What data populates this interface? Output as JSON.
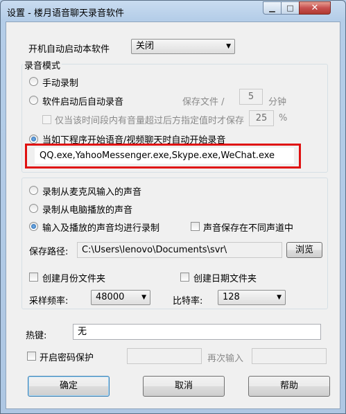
{
  "window": {
    "title": "设置 - 楼月语音聊天录音软件",
    "minimize_label": "▁",
    "maximize_label": "□",
    "close_label": "✕"
  },
  "autostart": {
    "label": "开机自动启动本软件",
    "value": "关闭"
  },
  "record_mode": {
    "title": "录音模式",
    "manual": "手动录制",
    "auto_on_start": "软件启动后自动录音",
    "save_file_label": "保存文件 /",
    "save_minutes": "5",
    "minutes_unit": "分钟",
    "volume_option": "仅当该时间段内有音量超过后方指定值时才保存",
    "volume_value": "25",
    "percent_unit": "%",
    "program_option": "当如下程序开始语音/视频聊天时自动开始录音",
    "programs": "QQ.exe,YahooMessenger.exe,Skype.exe,WeChat.exe"
  },
  "source": {
    "mic": "录制从麦克风输入的声音",
    "speaker": "录制从电脑播放的声音",
    "both": "输入及播放的声音均进行录制",
    "separate_channels": "声音保存在不同声道中",
    "path_label": "保存路径:",
    "path_value": "C:\\Users\\lenovo\\Documents\\svr\\",
    "browse": "浏览",
    "month_folder": "创建月份文件夹",
    "date_folder": "创建日期文件夹",
    "sample_rate_label": "采样频率:",
    "sample_rate_value": "48000",
    "bitrate_label": "比特率:",
    "bitrate_value": "128"
  },
  "hotkey": {
    "label": "热键:",
    "value": "无"
  },
  "password": {
    "enable": "开启密码保护",
    "repeat_label": "再次输入"
  },
  "buttons": {
    "ok": "确定",
    "cancel": "取消",
    "help": "帮助"
  },
  "colors": {
    "highlight_border": "#e01010",
    "radio_dot": "#1f5fa8"
  }
}
